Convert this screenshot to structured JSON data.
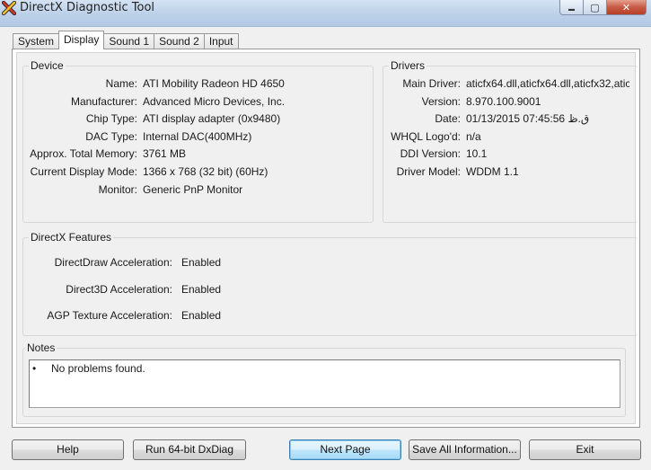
{
  "window": {
    "title": "DirectX Diagnostic Tool",
    "icon": "directx-x-icon",
    "caption": {
      "minimize": "▬",
      "maximize": "▢",
      "close": "✕"
    }
  },
  "tabs": [
    {
      "label": "System",
      "active": false
    },
    {
      "label": "Display",
      "active": true
    },
    {
      "label": "Sound 1",
      "active": false
    },
    {
      "label": "Sound 2",
      "active": false
    },
    {
      "label": "Input",
      "active": false
    }
  ],
  "device": {
    "legend": "Device",
    "rows": [
      {
        "label": "Name:",
        "value": "ATI Mobility Radeon HD 4650"
      },
      {
        "label": "Manufacturer:",
        "value": "Advanced Micro Devices, Inc."
      },
      {
        "label": "Chip Type:",
        "value": "ATI display adapter (0x9480)"
      },
      {
        "label": "DAC Type:",
        "value": "Internal DAC(400MHz)"
      },
      {
        "label": "Approx. Total Memory:",
        "value": "3761 MB"
      },
      {
        "label": "Current Display Mode:",
        "value": "1366 x 768 (32 bit) (60Hz)"
      },
      {
        "label": "Monitor:",
        "value": "Generic PnP Monitor"
      }
    ]
  },
  "drivers": {
    "legend": "Drivers",
    "rows": [
      {
        "label": "Main Driver:",
        "value": "aticfx64.dll,aticfx64.dll,aticfx32,aticf"
      },
      {
        "label": "Version:",
        "value": "8.970.100.9001"
      },
      {
        "label": "Date:",
        "value": "01/13/2015 07:45:56 ق.ظ"
      },
      {
        "label": "WHQL Logo'd:",
        "value": "n/a"
      },
      {
        "label": "DDI Version:",
        "value": "10.1"
      },
      {
        "label": "Driver Model:",
        "value": "WDDM 1.1"
      }
    ]
  },
  "features": {
    "legend": "DirectX Features",
    "rows": [
      {
        "label": "DirectDraw Acceleration:",
        "value": "Enabled"
      },
      {
        "label": "Direct3D Acceleration:",
        "value": "Enabled"
      },
      {
        "label": "AGP Texture Acceleration:",
        "value": "Enabled"
      }
    ]
  },
  "notes": {
    "legend": "Notes",
    "bullet": "•",
    "lines": [
      "No problems found."
    ]
  },
  "buttons": {
    "help": "Help",
    "run64": "Run 64-bit DxDiag",
    "next": "Next Page",
    "save": "Save All Information...",
    "exit": "Exit"
  }
}
